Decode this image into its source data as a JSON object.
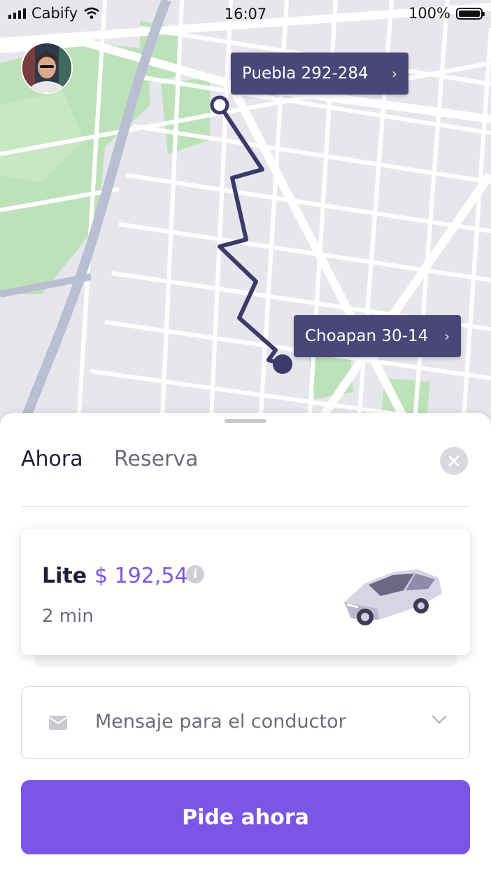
{
  "status_bar": {
    "carrier": "Cabify",
    "time": "16:07",
    "battery": "100%"
  },
  "map": {
    "origin_label": "Puebla 292-284",
    "destination_label": "Choapan 30-14",
    "colors": {
      "route": "#3c3a6b",
      "park": "#bde2b9",
      "block": "#e6e6ec",
      "road": "#ffffff"
    }
  },
  "sheet": {
    "tabs": [
      {
        "label": "Ahora",
        "active": true
      },
      {
        "label": "Reserva",
        "active": false
      }
    ],
    "option": {
      "name": "Lite",
      "price": "$ 192,54",
      "eta": "2 min",
      "info_icon": "i"
    },
    "message_placeholder": "Mensaje para el conductor",
    "cta_label": "Pide ahora"
  },
  "colors": {
    "accent": "#7b55e6",
    "tag": "#4a4778"
  }
}
